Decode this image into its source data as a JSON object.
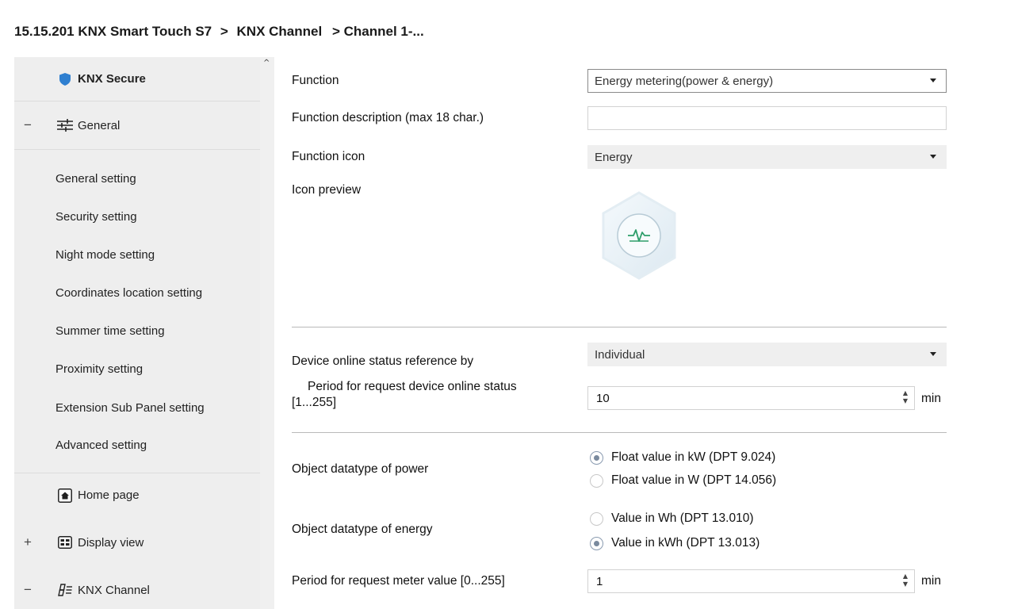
{
  "breadcrumb": {
    "device": "15.15.201 KNX Smart Touch S7",
    "sep1": ">",
    "channel": "KNX Channel",
    "sep2": "> Channel 1-..."
  },
  "sidebar": {
    "knx_secure": "KNX Secure",
    "general": {
      "expander": "−",
      "label": "General"
    },
    "sub_items": [
      "General setting",
      "Security setting",
      "Night mode setting",
      "Coordinates location setting",
      "Summer time setting",
      "Proximity setting",
      "Extension Sub Panel setting",
      "Advanced setting"
    ],
    "home_page": "Home page",
    "display_view": {
      "expander": "+",
      "label": "Display view"
    },
    "knx_channel": {
      "expander": "−",
      "label": "KNX Channel"
    },
    "scroll_up": "^"
  },
  "form": {
    "function": {
      "label": "Function",
      "value": "Energy metering(power & energy)"
    },
    "function_description": {
      "label": "Function description (max 18 char.)",
      "value": ""
    },
    "function_icon": {
      "label": "Function icon",
      "value": "Energy"
    },
    "icon_preview": {
      "label": "Icon preview",
      "icon": "energy-pulse-icon"
    },
    "device_online_status": {
      "label": "Device online status reference by",
      "value": "Individual"
    },
    "period_online_status": {
      "label_line1": "Period for request device online status",
      "label_line2": "[1...255]",
      "value": "10",
      "unit": "min"
    },
    "datatype_power": {
      "label": "Object datatype of power",
      "options": [
        "Float value in kW (DPT 9.024)",
        "Float value in W (DPT 14.056)"
      ],
      "selected": 0
    },
    "datatype_energy": {
      "label": "Object datatype of energy",
      "options": [
        "Value in Wh (DPT 13.010)",
        "Value in kWh (DPT 13.013)"
      ],
      "selected": 1
    },
    "period_meter": {
      "label": "Period for request meter value [0...255]",
      "value": "1",
      "unit": "min"
    }
  },
  "colors": {
    "shield": "#2f7fd0",
    "accent_green": "#2e9e6a",
    "sidebar_bg": "#eeeeee"
  }
}
